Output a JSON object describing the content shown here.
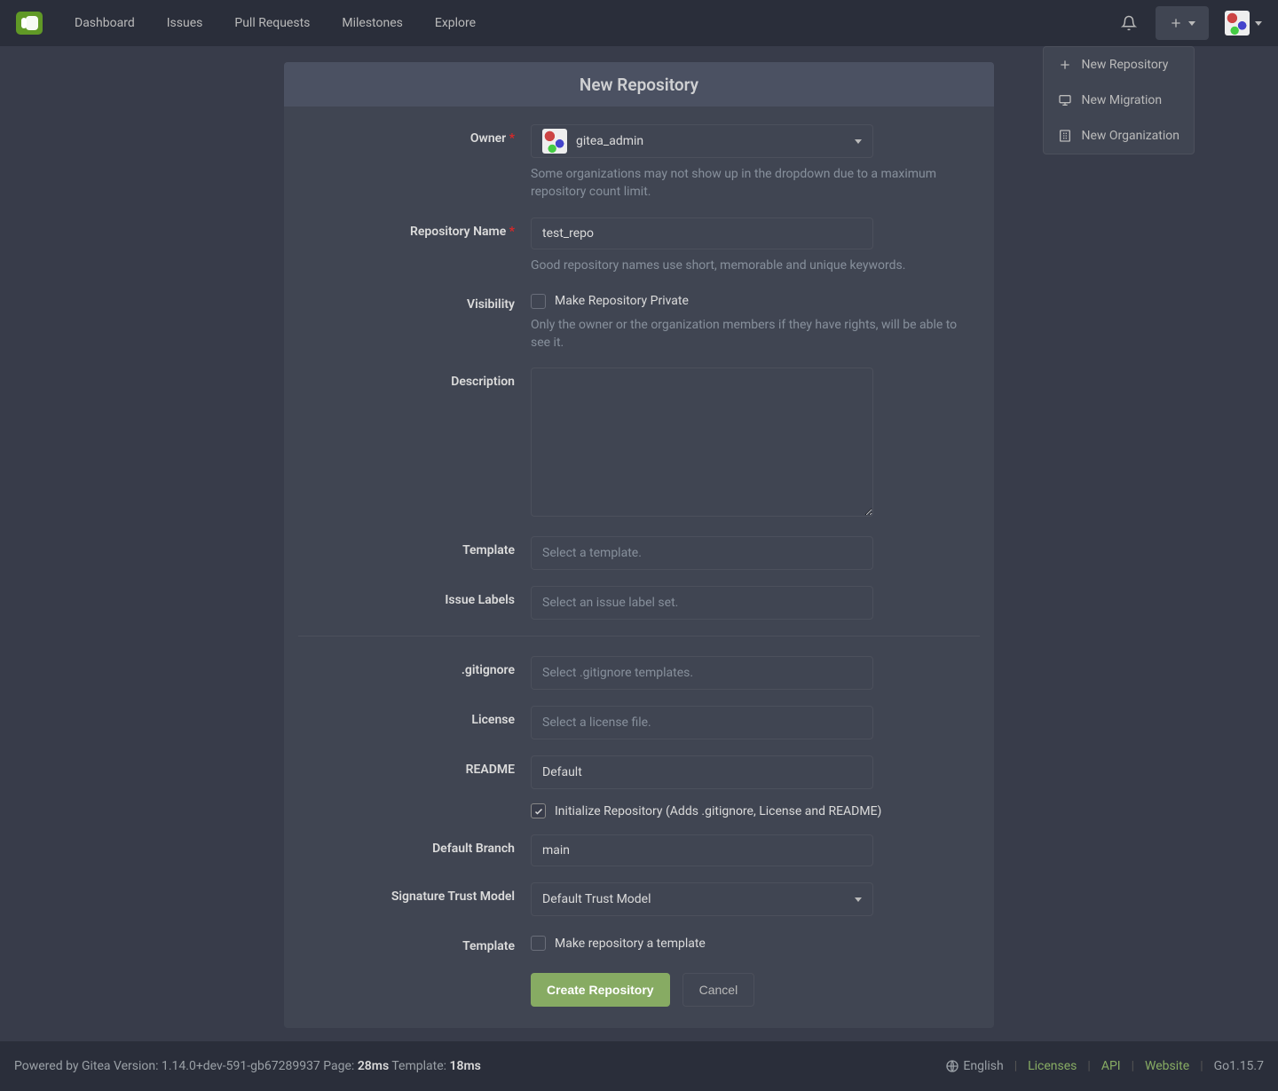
{
  "nav": {
    "items": [
      "Dashboard",
      "Issues",
      "Pull Requests",
      "Milestones",
      "Explore"
    ]
  },
  "create_menu": {
    "items": [
      {
        "label": "New Repository",
        "icon": "plus-icon"
      },
      {
        "label": "New Migration",
        "icon": "migration-icon"
      },
      {
        "label": "New Organization",
        "icon": "organization-icon"
      }
    ]
  },
  "page": {
    "title": "New Repository"
  },
  "form": {
    "owner": {
      "label": "Owner",
      "value": "gitea_admin",
      "help": "Some organizations may not show up in the dropdown due to a maximum repository count limit."
    },
    "repo_name": {
      "label": "Repository Name",
      "value": "test_repo",
      "help": "Good repository names use short, memorable and unique keywords."
    },
    "visibility": {
      "label": "Visibility",
      "checkbox_label": "Make Repository Private",
      "checked": false,
      "help": "Only the owner or the organization members if they have rights, will be able to see it."
    },
    "description": {
      "label": "Description",
      "value": ""
    },
    "template": {
      "label": "Template",
      "placeholder": "Select a template."
    },
    "issue_labels": {
      "label": "Issue Labels",
      "placeholder": "Select an issue label set."
    },
    "gitignore": {
      "label": ".gitignore",
      "placeholder": "Select .gitignore templates."
    },
    "license": {
      "label": "License",
      "placeholder": "Select a license file."
    },
    "readme": {
      "label": "README",
      "value": "Default"
    },
    "init_repo": {
      "label": "Initialize Repository (Adds .gitignore, License and README)",
      "checked": true
    },
    "default_branch": {
      "label": "Default Branch",
      "value": "main"
    },
    "trust_model": {
      "label": "Signature Trust Model",
      "value": "Default Trust Model"
    },
    "make_template": {
      "label": "Template",
      "checkbox_label": "Make repository a template",
      "checked": false
    },
    "submit": "Create Repository",
    "cancel": "Cancel"
  },
  "footer": {
    "powered_prefix": "Powered by Gitea Version: 1.14.0+dev-591-gb67289937 Page: ",
    "page_time": "28ms",
    "template_prefix": " Template: ",
    "template_time": "18ms",
    "language": "English",
    "links": [
      "Licenses",
      "API",
      "Website"
    ],
    "go_version": "Go1.15.7"
  }
}
